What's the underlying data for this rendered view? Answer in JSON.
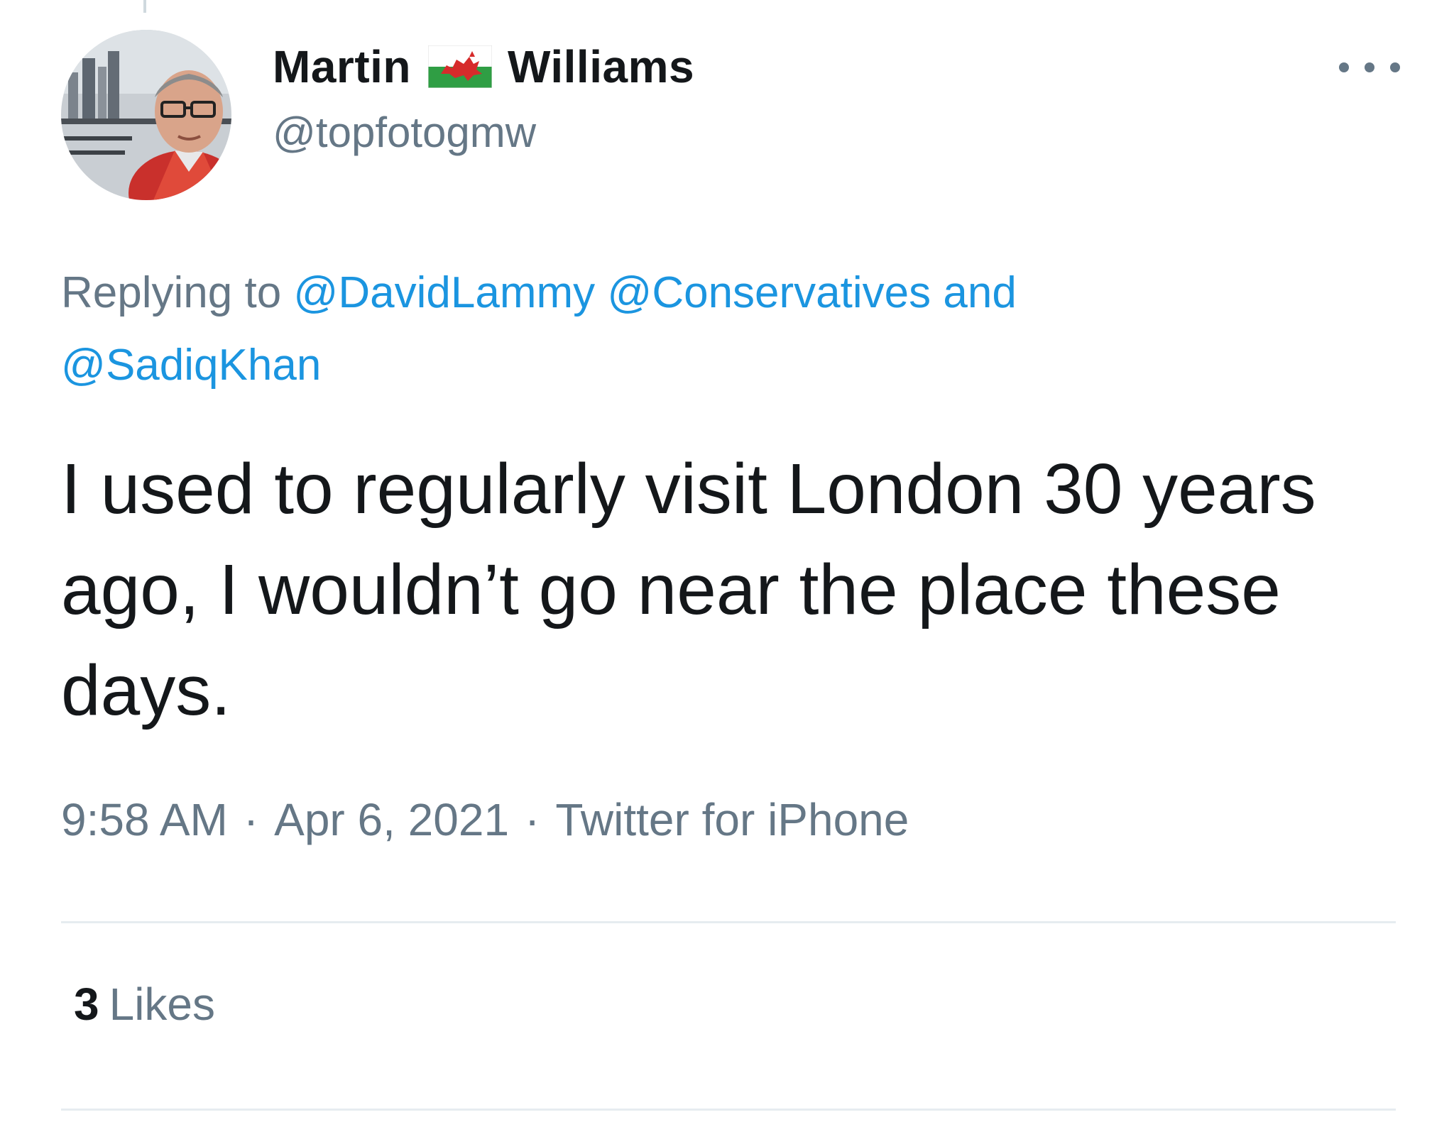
{
  "author": {
    "first_name": "Martin",
    "last_name": "Williams",
    "flag_icon": "welsh-flag-icon",
    "handle": "@topfotogmw"
  },
  "reply_context": {
    "prefix": "Replying to",
    "mentions": [
      "@DavidLammy",
      "@Conservatives",
      "@SadiqKhan"
    ],
    "conjunction": "and"
  },
  "tweet": {
    "text": "I used to regularly visit London 30 years ago, I wouldn’t go near the place these days."
  },
  "meta": {
    "time": "9:58 AM",
    "date": "Apr 6, 2021",
    "source": "Twitter for iPhone",
    "separator": "·"
  },
  "stats": {
    "likes_count": "3",
    "likes_label": "Likes"
  },
  "colors": {
    "link": "#1b95e0",
    "secondary_text": "#657786",
    "primary_text": "#14171a",
    "divider": "#e6ecf0"
  }
}
